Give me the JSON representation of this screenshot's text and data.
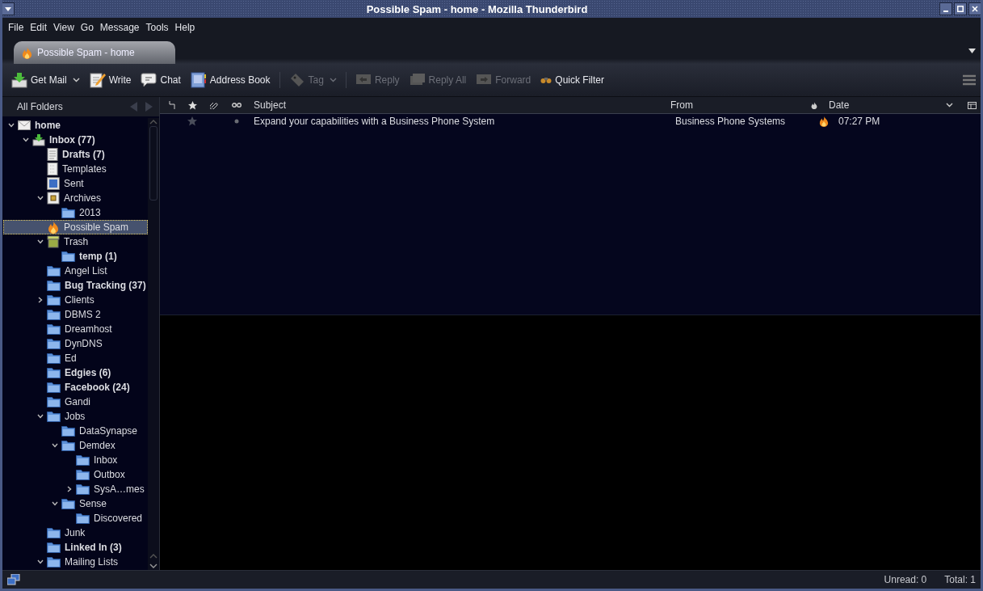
{
  "window": {
    "title": "Possible Spam - home - Mozilla Thunderbird"
  },
  "menu": [
    "File",
    "Edit",
    "View",
    "Go",
    "Message",
    "Tools",
    "Help"
  ],
  "tabs": [
    {
      "label": "Possible Spam - home",
      "selected": true
    }
  ],
  "toolbar": [
    {
      "label": "Get Mail",
      "kind": "getmail",
      "disabled": false,
      "dropdown": true
    },
    {
      "label": "Write",
      "kind": "write",
      "disabled": false,
      "dropdown": false
    },
    {
      "label": "Chat",
      "kind": "chat",
      "disabled": false,
      "dropdown": false
    },
    {
      "label": "Address Book",
      "kind": "addressbook",
      "disabled": false,
      "dropdown": false
    },
    {
      "label": "Tag",
      "kind": "tag",
      "disabled": true,
      "dropdown": true
    },
    {
      "label": "Reply",
      "kind": "reply",
      "disabled": true,
      "dropdown": false
    },
    {
      "label": "Reply All",
      "kind": "replyall",
      "disabled": true,
      "dropdown": false
    },
    {
      "label": "Forward",
      "kind": "forward",
      "disabled": true,
      "dropdown": false
    },
    {
      "label": "Quick Filter",
      "kind": "quickfilter",
      "disabled": false,
      "dropdown": false
    }
  ],
  "folder_pane": {
    "header": "All Folders",
    "folders": [
      {
        "name": "home",
        "kind": "account",
        "bold": true,
        "selected": false,
        "expanded": true,
        "children": [
          {
            "name": "Inbox (77)",
            "kind": "inbox",
            "bold": true,
            "selected": false,
            "expanded": true,
            "children": [
              {
                "name": "Drafts (7)",
                "kind": "drafts",
                "bold": true,
                "selected": false
              },
              {
                "name": "Templates",
                "kind": "templates",
                "bold": false,
                "selected": false
              },
              {
                "name": "Sent",
                "kind": "sent",
                "bold": false,
                "selected": false
              },
              {
                "name": "Archives",
                "kind": "archives",
                "bold": false,
                "selected": false,
                "expanded": true,
                "children": [
                  {
                    "name": "2013",
                    "kind": "folder",
                    "bold": false,
                    "selected": false
                  }
                ]
              },
              {
                "name": "Possible Spam",
                "kind": "spam",
                "bold": false,
                "selected": true
              },
              {
                "name": "Trash",
                "kind": "trash",
                "bold": false,
                "selected": false,
                "expanded": true,
                "children": [
                  {
                    "name": "temp (1)",
                    "kind": "folder",
                    "bold": true,
                    "selected": false
                  }
                ]
              },
              {
                "name": "Angel List",
                "kind": "folder",
                "bold": false,
                "selected": false
              },
              {
                "name": "Bug Tracking (37)",
                "kind": "folder",
                "bold": true,
                "selected": false
              },
              {
                "name": "Clients",
                "kind": "folder",
                "bold": false,
                "selected": false,
                "expanded": false
              },
              {
                "name": "DBMS 2",
                "kind": "folder",
                "bold": false,
                "selected": false
              },
              {
                "name": "Dreamhost",
                "kind": "folder",
                "bold": false,
                "selected": false
              },
              {
                "name": "DynDNS",
                "kind": "folder",
                "bold": false,
                "selected": false
              },
              {
                "name": "Ed",
                "kind": "folder",
                "bold": false,
                "selected": false
              },
              {
                "name": "Edgies (6)",
                "kind": "folder",
                "bold": true,
                "selected": false
              },
              {
                "name": "Facebook (24)",
                "kind": "folder",
                "bold": true,
                "selected": false
              },
              {
                "name": "Gandi",
                "kind": "folder",
                "bold": false,
                "selected": false
              },
              {
                "name": "Jobs",
                "kind": "folder",
                "bold": false,
                "selected": false,
                "expanded": true,
                "children": [
                  {
                    "name": "DataSynapse",
                    "kind": "folder",
                    "bold": false,
                    "selected": false
                  },
                  {
                    "name": "Demdex",
                    "kind": "folder",
                    "bold": false,
                    "selected": false,
                    "expanded": true,
                    "children": [
                      {
                        "name": "Inbox",
                        "kind": "folder",
                        "bold": false,
                        "selected": false
                      },
                      {
                        "name": "Outbox",
                        "kind": "folder",
                        "bold": false,
                        "selected": false
                      },
                      {
                        "name": "SysA…mes",
                        "kind": "folder",
                        "bold": false,
                        "selected": false,
                        "expanded": false
                      }
                    ]
                  },
                  {
                    "name": "Sense",
                    "kind": "folder",
                    "bold": false,
                    "selected": false,
                    "expanded": true,
                    "children": [
                      {
                        "name": "Discovered",
                        "kind": "folder",
                        "bold": false,
                        "selected": false
                      }
                    ]
                  }
                ]
              },
              {
                "name": "Junk",
                "kind": "folder",
                "bold": false,
                "selected": false
              },
              {
                "name": "Linked In (3)",
                "kind": "folder",
                "bold": true,
                "selected": false
              },
              {
                "name": "Mailing Lists",
                "kind": "folder",
                "bold": false,
                "selected": false,
                "expanded": true
              }
            ]
          }
        ]
      }
    ]
  },
  "message_list": {
    "columns": [
      {
        "kind": "thread"
      },
      {
        "kind": "star"
      },
      {
        "kind": "attachment"
      },
      {
        "kind": "read"
      },
      {
        "kind": "text",
        "label": "Subject",
        "sorted": false
      },
      {
        "kind": "text",
        "label": "From",
        "sorted": false
      },
      {
        "kind": "junk"
      },
      {
        "kind": "text",
        "label": "Date",
        "sorted": true
      }
    ],
    "messages": [
      {
        "starred": false,
        "read": true,
        "subject": "Expand your capabilities with a Business Phone System",
        "from": "Business Phone Systems",
        "junk": true,
        "date": "07:27 PM",
        "selected": false
      }
    ]
  },
  "status_bar": {
    "unread": "Unread: 0",
    "total": "Total: 1"
  }
}
